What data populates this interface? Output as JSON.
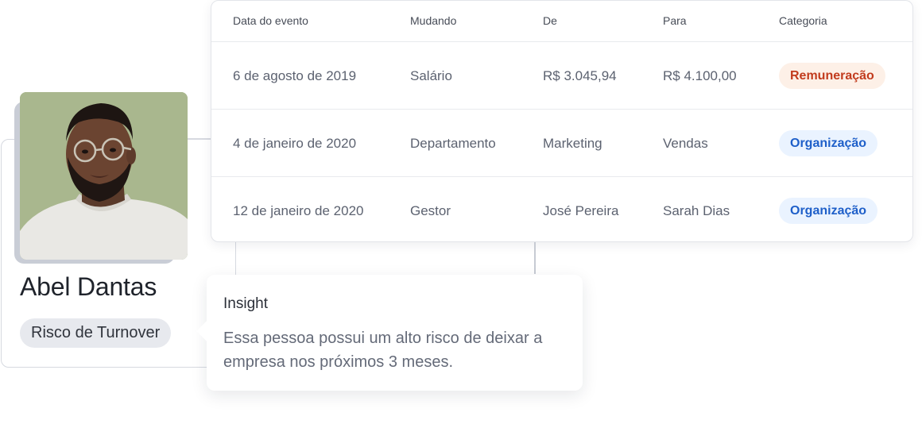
{
  "profile": {
    "name": "Abel Dantas",
    "risk_label": "Risco de Turnover"
  },
  "table": {
    "headers": [
      "Data do evento",
      "Mudando",
      "De",
      "Para",
      "Categoria"
    ],
    "rows": [
      {
        "date": "6 de agosto de 2019",
        "changing": "Salário",
        "from": "R$ 3.045,94",
        "to": "R$ 4.100,00",
        "category": "Remuneração",
        "category_color": "#c23b1d",
        "category_bg": "#fdf0e7"
      },
      {
        "date": "4 de janeiro de 2020",
        "changing": "Departamento",
        "from": "Marketing",
        "to": "Vendas",
        "category": "Organização",
        "category_color": "#1e5fc9",
        "category_bg": "#eaf3ff"
      },
      {
        "date": "12 de janeiro de 2020",
        "changing": "Gestor",
        "from": "José Pereira",
        "to": "Sarah Dias",
        "category": "Organização",
        "category_color": "#1e5fc9",
        "category_bg": "#eaf3ff"
      }
    ]
  },
  "insight": {
    "title": "Insight",
    "body": "Essa pessoa possui um alto risco de deixar a empresa nos próximos 3 meses."
  }
}
